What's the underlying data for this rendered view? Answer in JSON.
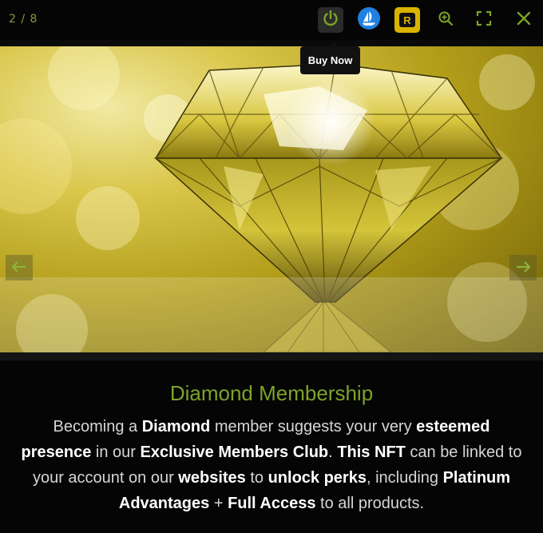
{
  "counter": "2 / 8",
  "toolbar": {
    "tooltip": "Buy Now",
    "accent_color": "#7ba428",
    "icons": [
      "power-icon",
      "opensea-icon",
      "rarible-icon",
      "zoom-in-icon",
      "fullscreen-icon",
      "close-icon"
    ]
  },
  "caption": {
    "title": "Diamond Membership",
    "text": {
      "p1": "Becoming a ",
      "b1": "Diamond",
      "p2": " member suggests your very ",
      "b2": "esteemed presence",
      "p3": " in our ",
      "b3": "Exclusive Members Club",
      "p4": ". ",
      "b4": "This NFT",
      "p5": " can be linked to your account on our ",
      "b5": "websites",
      "p6": " to ",
      "b6": "unlock perks",
      "p7": ", including ",
      "b7": "Platinum Advantages",
      "p8": " + ",
      "b8": "Full Access",
      "p9": " to all products."
    }
  },
  "rarible_letter": "R"
}
